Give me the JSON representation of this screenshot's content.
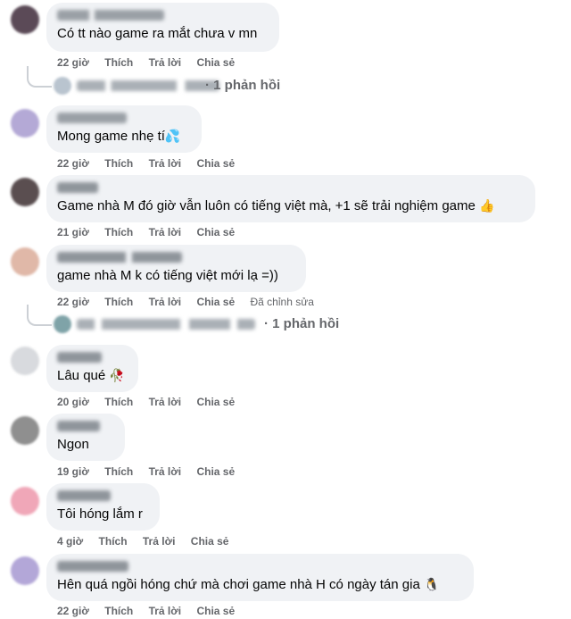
{
  "comments": [
    {
      "text": "Có tt nào game ra mắt chưa v mn",
      "time": "22 giờ",
      "actions": [
        "Thích",
        "Trả lời",
        "Chia sẻ"
      ],
      "reply_summary": "· 1 phản hồi"
    },
    {
      "text": "Mong game nhẹ tí",
      "emoji": "💦",
      "time": "22 giờ",
      "actions": [
        "Thích",
        "Trả lời",
        "Chia sẻ"
      ]
    },
    {
      "text": "Game nhà M đó giờ vẫn luôn có tiếng việt mà, +1 sẽ trải nghiệm game",
      "emoji": "👍",
      "time": "21 giờ",
      "actions": [
        "Thích",
        "Trả lời",
        "Chia sẻ"
      ]
    },
    {
      "text": "game nhà M k có tiếng việt mới lạ =))",
      "time": "22 giờ",
      "actions": [
        "Thích",
        "Trả lời",
        "Chia sẻ",
        "Đã chỉnh sửa"
      ],
      "reply_summary": "· 1 phản hồi"
    },
    {
      "text": "Lâu qué",
      "emoji": "🥀",
      "time": "20 giờ",
      "actions": [
        "Thích",
        "Trả lời",
        "Chia sẻ"
      ]
    },
    {
      "text": "Ngon",
      "time": "19 giờ",
      "actions": [
        "Thích",
        "Trả lời",
        "Chia sẻ"
      ]
    },
    {
      "text": "Tôi hóng lắm r",
      "time": "4 giờ",
      "actions": [
        "Thích",
        "Trả lời",
        "Chia sẻ"
      ]
    },
    {
      "text": "Hên quá ngồi hóng chứ mà chơi game nhà H có ngày tán gia",
      "emoji": "🐧",
      "time": "22 giờ",
      "actions": [
        "Thích",
        "Trả lời",
        "Chia sẻ"
      ]
    }
  ],
  "colors": {
    "bubble": "#f0f2f5",
    "meta": "#65676b",
    "text": "#050505"
  }
}
